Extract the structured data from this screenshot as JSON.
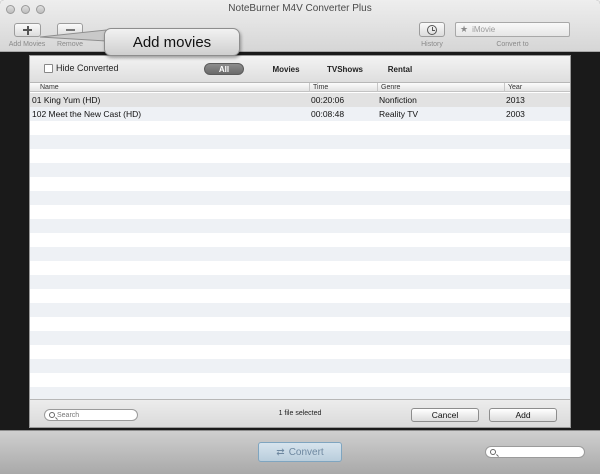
{
  "window": {
    "title": "NoteBurner M4V Converter Plus"
  },
  "toolbar": {
    "add_movies_label": "Add Movies",
    "remove_label": "Remove",
    "history_label": "History",
    "convert_to_label": "Convert to",
    "convert_to_value": "iMovie"
  },
  "callout": {
    "text": "Add movies"
  },
  "filter": {
    "hide_converted_label": "Hide Converted",
    "tabs": [
      "All",
      "Movies",
      "TVShows",
      "Rental"
    ],
    "active_tab": "All"
  },
  "table": {
    "columns": [
      "Name",
      "Time",
      "Genre",
      "Year"
    ],
    "rows": [
      {
        "name": "01 King Yum (HD)",
        "time": "00:20:06",
        "genre": "Nonfiction",
        "year": "2013"
      },
      {
        "name": "102 Meet the New Cast (HD)",
        "time": "00:08:48",
        "genre": "Reality TV",
        "year": "2003"
      }
    ]
  },
  "footer": {
    "search_placeholder": "Search",
    "status": "1 file selected",
    "cancel_label": "Cancel",
    "add_label": "Add"
  },
  "bottom": {
    "convert_label": "Convert"
  },
  "icons": {
    "add": "plus-icon",
    "remove": "minus-icon",
    "history": "clock-icon",
    "convert_to": "star-icon",
    "search": "search-icon",
    "convert": "convert-arrows-icon"
  }
}
